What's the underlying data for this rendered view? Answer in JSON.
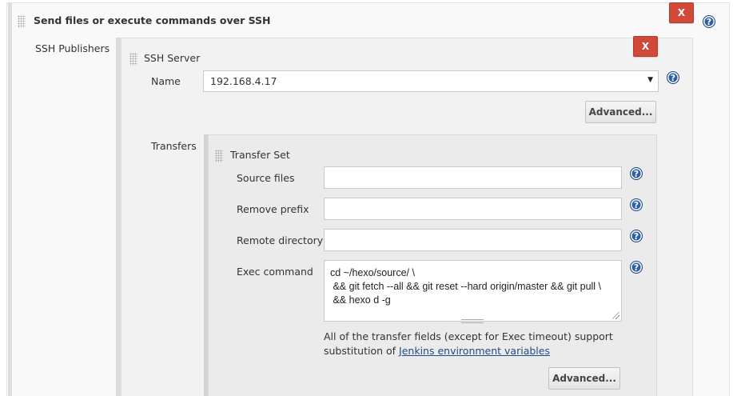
{
  "section": {
    "title": "Send files or execute commands over SSH",
    "delete_label": "X",
    "help_label": "?"
  },
  "publishers": {
    "label": "SSH Publishers"
  },
  "server": {
    "title": "SSH Server",
    "delete_label": "X",
    "name_label": "Name",
    "name_value": "192.168.4.17",
    "advanced_label": "Advanced...",
    "transfers_label": "Transfers"
  },
  "transfer_set": {
    "title": "Transfer Set",
    "source_files_label": "Source files",
    "source_files_value": "",
    "remove_prefix_label": "Remove prefix",
    "remove_prefix_value": "",
    "remote_directory_label": "Remote directory",
    "remote_directory_value": "",
    "exec_command_label": "Exec command",
    "exec_command_value": "cd ~/hexo/source/ \\\n && git fetch --all && git reset --hard origin/master && git pull \\\n && hexo d -g",
    "note_text": "All of the transfer fields (except for Exec timeout) support substitution of ",
    "note_link": "Jenkins environment variables",
    "advanced_label": "Advanced..."
  },
  "colors": {
    "delete_button": "#d24939",
    "help_icon": "#2e5fa4",
    "link": "#204a87"
  }
}
